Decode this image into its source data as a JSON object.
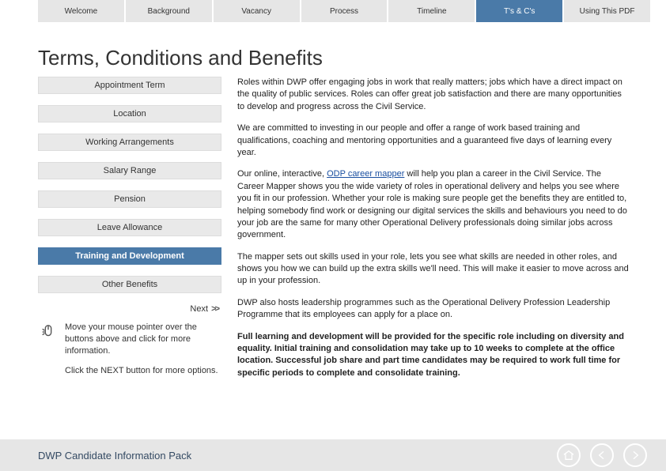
{
  "nav": {
    "tabs": [
      {
        "label": "Welcome"
      },
      {
        "label": "Background"
      },
      {
        "label": "Vacancy"
      },
      {
        "label": "Process"
      },
      {
        "label": "Timeline"
      },
      {
        "label": "T's & C's"
      },
      {
        "label": "Using This PDF"
      }
    ],
    "active_index": 5
  },
  "page": {
    "title": "Terms, Conditions and Benefits"
  },
  "sidebar": {
    "items": [
      {
        "label": "Appointment Term"
      },
      {
        "label": "Location"
      },
      {
        "label": "Working Arrangements"
      },
      {
        "label": "Salary Range"
      },
      {
        "label": "Pension"
      },
      {
        "label": "Leave Allowance"
      },
      {
        "label": "Training and Development"
      },
      {
        "label": "Other Benefits"
      }
    ],
    "active_index": 6,
    "next_label": "Next",
    "hint1": "Move your mouse pointer over the buttons above and click for more information.",
    "hint2": "Click the NEXT button for more options."
  },
  "content": {
    "p1": "Roles within DWP offer engaging jobs in work that really matters; jobs which have a direct impact on the quality of public services. Roles can offer great job satisfaction and there are many opportunities to develop and progress across the Civil Service.",
    "p2": "We are committed to investing in our people and offer a range of work based training and qualifications, coaching and mentoring opportunities and a guaranteed five days of learning every year.",
    "p3a": "Our online, interactive, ",
    "p3link": "ODP career mapper",
    "p3b": " will help you plan a career in the Civil Service. The Career Mapper shows you the wide variety of roles in operational delivery and helps you see where you fit in our profession. Whether your role is making sure people get the benefits they are entitled to, helping somebody find work or designing our digital services the skills and behaviours you need to do your job are the same for many other Operational Delivery professionals doing similar jobs across government.",
    "p4": "The mapper sets out skills used in your role, lets you see what skills are needed in other roles, and shows you how we can build up the extra skills we'll need.  This will make it easier to move across and up in your profession.",
    "p5": "DWP also hosts leadership programmes such as the Operational Delivery Profession Leadership Programme that its employees can apply for a place on.",
    "p6": "Full learning and development will be provided for the specific role including on diversity and equality. Initial training and consolidation may take up to 10 weeks to complete at the office location. Successful job share and part time candidates may be required to work full time for specific periods to complete and consolidate training."
  },
  "footer": {
    "title": "DWP Candidate Information Pack"
  }
}
